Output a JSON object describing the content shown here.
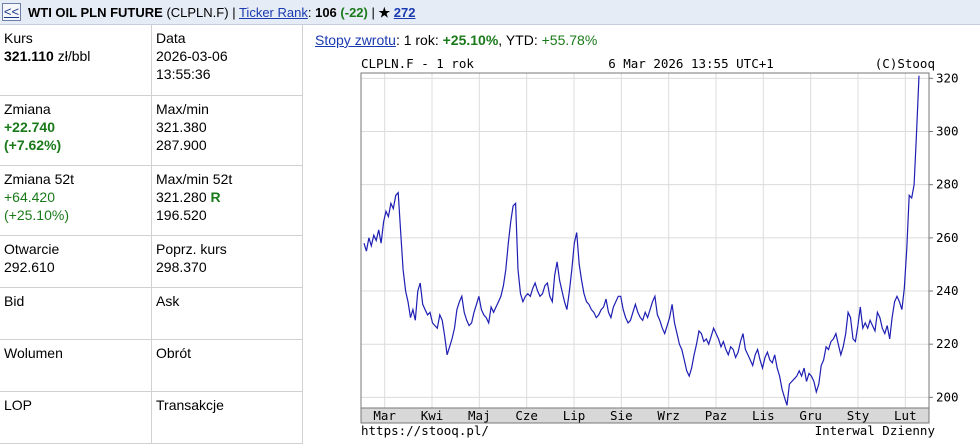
{
  "topbar": {
    "back_label": "<<",
    "name": "WTI OIL PLN FUTURE",
    "ticker": "(CLPLN.F)",
    "sep1": "|",
    "rank_link": "Ticker Rank",
    "rank_colon": ":",
    "rank_value": "106",
    "rank_change": "(-22)",
    "sep2": "|",
    "star": "★",
    "star_count": "272"
  },
  "quote": {
    "kurs_label": "Kurs",
    "kurs_value": "321.110",
    "kurs_unit": "zł/bbl",
    "data_label": "Data",
    "data_date": "2026-03-06",
    "data_time": "13:55:36",
    "zmiana_label": "Zmiana",
    "zmiana_value": "+22.740",
    "zmiana_pct": "(+7.62%)",
    "maxmin_label": "Max/min",
    "max_value": "321.380",
    "min_value": "287.900",
    "zmiana52_label": "Zmiana 52t",
    "zmiana52_value": "+64.420",
    "zmiana52_pct": "(+25.10%)",
    "maxmin52_label": "Max/min 52t",
    "max52_value": "321.280",
    "max52_flag": "R",
    "min52_value": "196.520",
    "otwarcie_label": "Otwarcie",
    "otwarcie_value": "292.610",
    "poprz_label": "Poprz. kurs",
    "poprz_value": "298.370",
    "bid_label": "Bid",
    "ask_label": "Ask",
    "wolumen_label": "Wolumen",
    "obrot_label": "Obrót",
    "lop_label": "LOP",
    "transakcje_label": "Transakcje"
  },
  "returns": {
    "link": "Stopy zwrotu",
    "colon": ":",
    "period": "1 rok:",
    "value": "+25.10%",
    "ytd_label": ", YTD:",
    "ytd_value": "+55.78%"
  },
  "colors": {
    "line": "#1e1eb4",
    "grid": "#dcdcdc",
    "axis_band": "#d8d8d8",
    "positive": "#1a7a1a",
    "link": "#1a3ab0"
  },
  "chart_data": {
    "type": "line",
    "header_left": "CLPLN.F - 1 rok",
    "header_center": "6 Mar 2026 13:55 UTC+1",
    "header_right": "(C)Stooq",
    "footer_left": "https://stooq.pl/",
    "footer_right": "Interwal Dzienny",
    "categories": [
      "Mar",
      "Kwi",
      "Maj",
      "Cze",
      "Lip",
      "Sie",
      "Wrz",
      "Paz",
      "Lis",
      "Gru",
      "Sty",
      "Lut"
    ],
    "yticks": [
      200,
      220,
      240,
      260,
      280,
      300,
      320
    ],
    "ylim": [
      196,
      322
    ],
    "grid": true,
    "series": [
      {
        "values": [
          258,
          255,
          260,
          257,
          261,
          259,
          263,
          258,
          266,
          270,
          268,
          273,
          271,
          276,
          277,
          262,
          248,
          240,
          236,
          230,
          233,
          229,
          240,
          243,
          235,
          233,
          231,
          232,
          228,
          227,
          226,
          231,
          229,
          223,
          216,
          219,
          222,
          226,
          233,
          236,
          238,
          232,
          229,
          227,
          228,
          232,
          235,
          238,
          233,
          231,
          230,
          228,
          234,
          232,
          234,
          236,
          238,
          242,
          248,
          258,
          266,
          272,
          273,
          248,
          239,
          236,
          238,
          239,
          238,
          241,
          243,
          240,
          238,
          239,
          242,
          243,
          238,
          236,
          246,
          251,
          244,
          240,
          236,
          233,
          240,
          248,
          258,
          262,
          250,
          244,
          239,
          236,
          235,
          233,
          232,
          230,
          231,
          233,
          234,
          237,
          232,
          230,
          234,
          236,
          238,
          238,
          233,
          230,
          228,
          229,
          232,
          235,
          232,
          230,
          229,
          232,
          230,
          233,
          236,
          238,
          231,
          229,
          226,
          224,
          227,
          230,
          235,
          228,
          224,
          220,
          218,
          214,
          210,
          208,
          211,
          216,
          220,
          225,
          224,
          221,
          222,
          220,
          223,
          226,
          224,
          222,
          219,
          221,
          218,
          216,
          219,
          218,
          215,
          217,
          221,
          224,
          218,
          216,
          214,
          212,
          216,
          218,
          214,
          211,
          215,
          217,
          214,
          213,
          216,
          211,
          208,
          203,
          200,
          197,
          205,
          206,
          207,
          208,
          210,
          208,
          211,
          206,
          209,
          208,
          206,
          202,
          205,
          212,
          214,
          219,
          218,
          221,
          222,
          224,
          220,
          216,
          219,
          224,
          232,
          230,
          222,
          221,
          227,
          234,
          226,
          228,
          226,
          229,
          227,
          225,
          232,
          230,
          226,
          224,
          227,
          222,
          230,
          236,
          238,
          236,
          233,
          241,
          256,
          276,
          275,
          280,
          300,
          321
        ]
      }
    ]
  }
}
